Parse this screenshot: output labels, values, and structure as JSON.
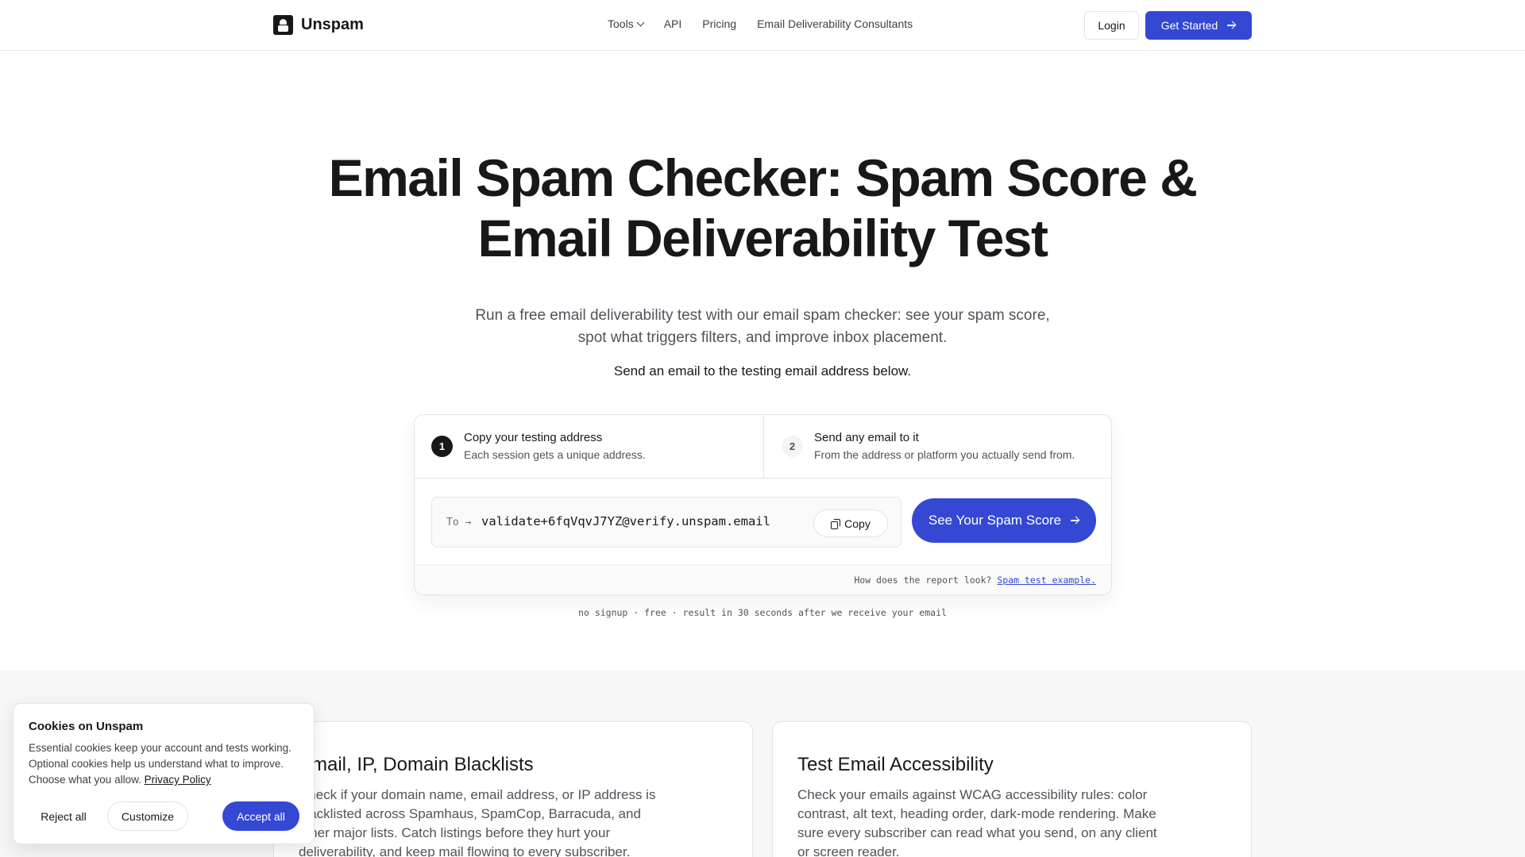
{
  "header": {
    "brand": "Unspam",
    "nav": {
      "tools": "Tools",
      "api": "API",
      "pricing": "Pricing",
      "consultants": "Email Deliverability Consultants"
    },
    "login": "Login",
    "get_started": "Get Started"
  },
  "hero": {
    "title_line1": "Email Spam Checker: Spam Score &",
    "title_line2": "Email Deliverability Test",
    "subtitle_line1": "Run a free email deliverability test with our email spam checker: see your spam score,",
    "subtitle_line2": "spot what triggers filters, and improve inbox placement.",
    "cta_text": "Send an email to the testing email address below."
  },
  "test_card": {
    "step1": {
      "number": "1",
      "title": "Copy your testing address",
      "desc": "Each session gets a unique address."
    },
    "step2": {
      "number": "2",
      "title": "Send any email to it",
      "desc": "From the address or platform you actually send from."
    },
    "to_label": "To →",
    "address": "validate+6fqVqvJ7YZ@verify.unspam.email",
    "copy_label": "Copy",
    "score_button": "See Your Spam Score",
    "report_question": "How does the report look?",
    "report_link": "Spam test example.",
    "note": "no signup · free · result in 30 seconds after we receive your email"
  },
  "features": [
    {
      "title": "Email, IP, Domain Blacklists",
      "body": "Check if your domain name, email address, or IP address is blacklisted across Spamhaus, SpamCop, Barracuda, and other major lists. Catch listings before they hurt your deliverability, and keep mail flowing to every subscriber."
    },
    {
      "title": "Test Email Accessibility",
      "body": "Check your emails against WCAG accessibility rules: color contrast, alt text, heading order, dark-mode rendering. Make sure every subscriber can read what you send, on any client or screen reader."
    }
  ],
  "cookie": {
    "title": "Cookies on Unspam",
    "body": "Essential cookies keep your account and tests working. Optional cookies help us understand what to improve. Choose what you allow.",
    "privacy_link": "Privacy Policy",
    "reject": "Reject all",
    "customize": "Customize",
    "accept": "Accept all"
  },
  "colors": {
    "accent": "#3548d4",
    "text": "#18181b",
    "muted": "#52525b"
  },
  "icons": [
    "logo-icon",
    "chevron-down-icon",
    "arrow-right-icon",
    "copy-icon"
  ]
}
